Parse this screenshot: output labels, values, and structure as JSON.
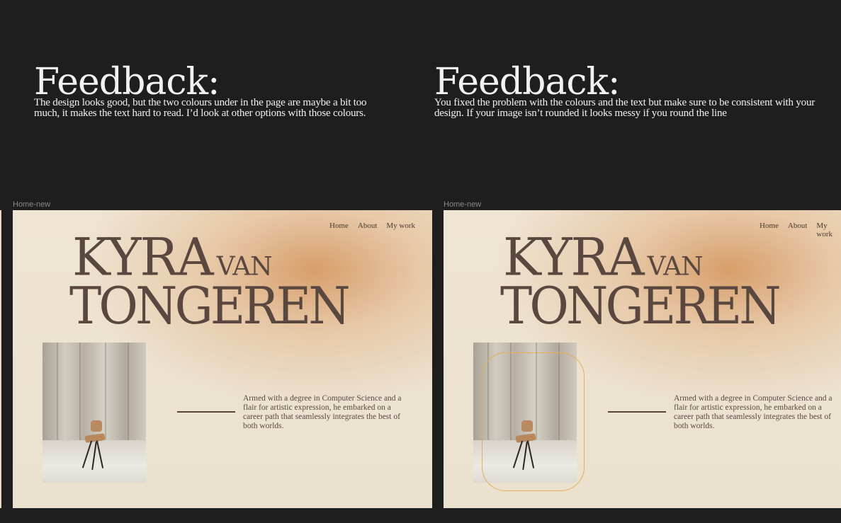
{
  "feedback_1": {
    "title": "Feedback:",
    "text": "The design looks good, but the two colours under in the page are maybe a bit too much, it makes the text hard to read. I’d look at other options with those colours."
  },
  "feedback_2": {
    "title": "Feedback:",
    "text": "You fixed the problem with the colours and the text but make sure to be consistent with your design. If your image isn’t rounded it looks messy if you round the line"
  },
  "frames": [
    {
      "label": "Home-new",
      "nav": [
        "Home",
        "About",
        "My work"
      ],
      "name_first": "KYRA",
      "name_mid": "VAN",
      "name_last": "TONGEREN",
      "bio": "Armed with a degree in Computer Science and a flair for artistic expression, he embarked on a career path that seamlessly integrates the best of both worlds."
    },
    {
      "label": "Home-new",
      "nav": [
        "Home",
        "About",
        "My work"
      ],
      "name_first": "KYRA",
      "name_mid": "VAN",
      "name_last": "TONGEREN",
      "bio": "Armed with a degree in Computer Science and a flair for artistic expression, he embarked on a career path that seamlessly integrates the best of both worlds."
    }
  ],
  "colors": {
    "canvas": "#1e1e1e",
    "text_brown": "#5a4840",
    "accent_orange": "#e9ad55",
    "gradient_peach": "#d69862"
  }
}
